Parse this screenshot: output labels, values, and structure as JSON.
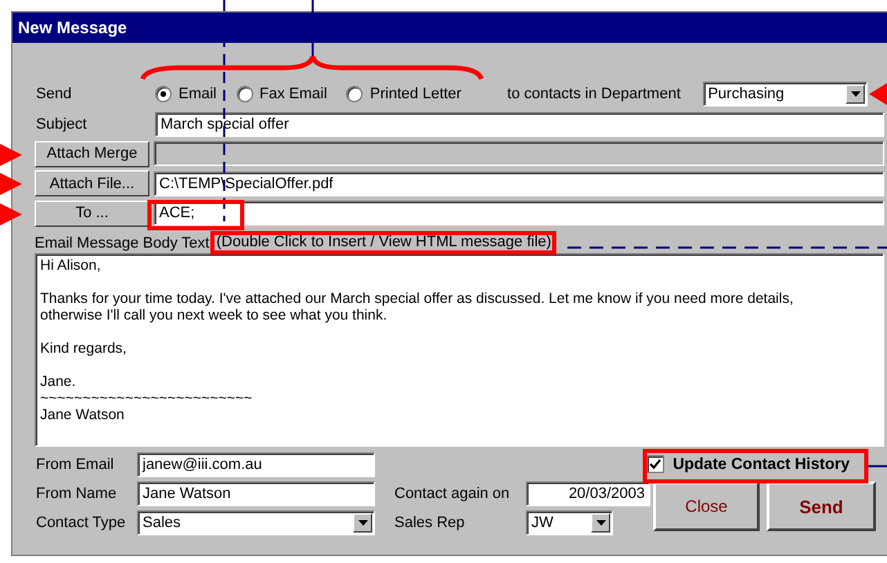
{
  "window": {
    "title": "New Message"
  },
  "send": {
    "label": "Send",
    "options": [
      {
        "label": "Email",
        "selected": true
      },
      {
        "label": "Fax Email",
        "selected": false
      },
      {
        "label": "Printed Letter",
        "selected": false
      }
    ],
    "department_label": "to contacts in Department",
    "department": "Purchasing"
  },
  "subject": {
    "label": "Subject",
    "value": "March special offer"
  },
  "attach_merge": {
    "button": "Attach Merge"
  },
  "attach_file": {
    "button": "Attach File...",
    "value": "C:\\TEMP\\SpecialOffer.pdf"
  },
  "to": {
    "button": "To ...",
    "value": "ACE;"
  },
  "body": {
    "label": "Email Message Body Text",
    "hint": "(Double Click to Insert / View HTML message file)",
    "paragraphs": [
      [
        "Hi Alison,"
      ],
      [
        "Thanks for your time today.  I've attached our March special offer as discussed.  Let me know if you need more details,",
        "otherwise I'll call you next week to see what you think."
      ],
      [
        "Kind regards,"
      ],
      [
        "Jane.",
        "~~~~~~~~~~~~~~~~~~~~~~~~~",
        "Jane Watson"
      ]
    ]
  },
  "from_email": {
    "label": "From Email",
    "value": "janew@iii.com.au"
  },
  "from_name": {
    "label": "From Name",
    "value": "Jane Watson"
  },
  "contact_type": {
    "label": "Contact Type",
    "value": "Sales"
  },
  "contact_again": {
    "label": "Contact again on",
    "value": "20/03/2003"
  },
  "sales_rep": {
    "label": "Sales Rep",
    "value": "JW"
  },
  "update_history": {
    "label": "Update Contact History",
    "checked": true
  },
  "buttons": [
    {
      "label": "Close",
      "kind": "close"
    },
    {
      "label": "Send",
      "kind": "send"
    }
  ]
}
